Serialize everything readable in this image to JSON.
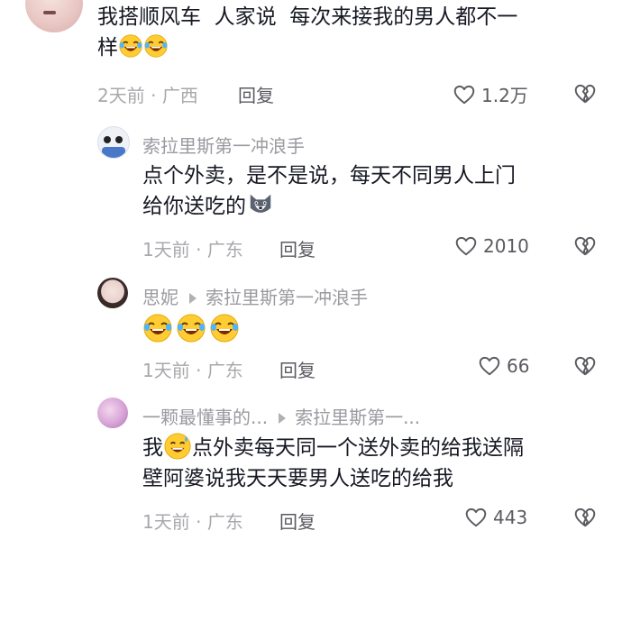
{
  "comment1": {
    "text_line1": "我搭顺风车  人家说  每次来接我的男人都不一",
    "text_line2": "样",
    "time": "2天前",
    "location": "广西",
    "reply_label": "回复",
    "likes": "1.2万"
  },
  "comment2": {
    "username": "索拉里斯第一冲浪手",
    "text_line1": "点个外卖，是不是说，每天不同男人上门",
    "text_line2": "给你送吃的",
    "time": "1天前",
    "location": "广东",
    "reply_label": "回复",
    "likes": "2010"
  },
  "comment3": {
    "username": "思妮",
    "reply_to": "索拉里斯第一冲浪手",
    "time": "1天前",
    "location": "广东",
    "reply_label": "回复",
    "likes": "66"
  },
  "comment4": {
    "username": "一颗最懂事的...",
    "reply_to": "索拉里斯第一...",
    "text_start": "我",
    "text_line1_rest": "点外卖每天同一个送外卖的给我送隔",
    "text_line2": "壁阿婆说我天天要男人送吃的给我",
    "time": "1天前",
    "location": "广东",
    "reply_label": "回复",
    "likes": "443"
  },
  "icons": {
    "like": "heart-outline-icon",
    "dislike": "broken-heart-icon",
    "laugh": "tears-of-joy-emoji",
    "dog": "dog-face-emoji",
    "sweat": "grinning-sweat-emoji"
  },
  "colors": {
    "text": "#161823",
    "meta": "#a8a8ad",
    "username": "#9a9aa0"
  }
}
